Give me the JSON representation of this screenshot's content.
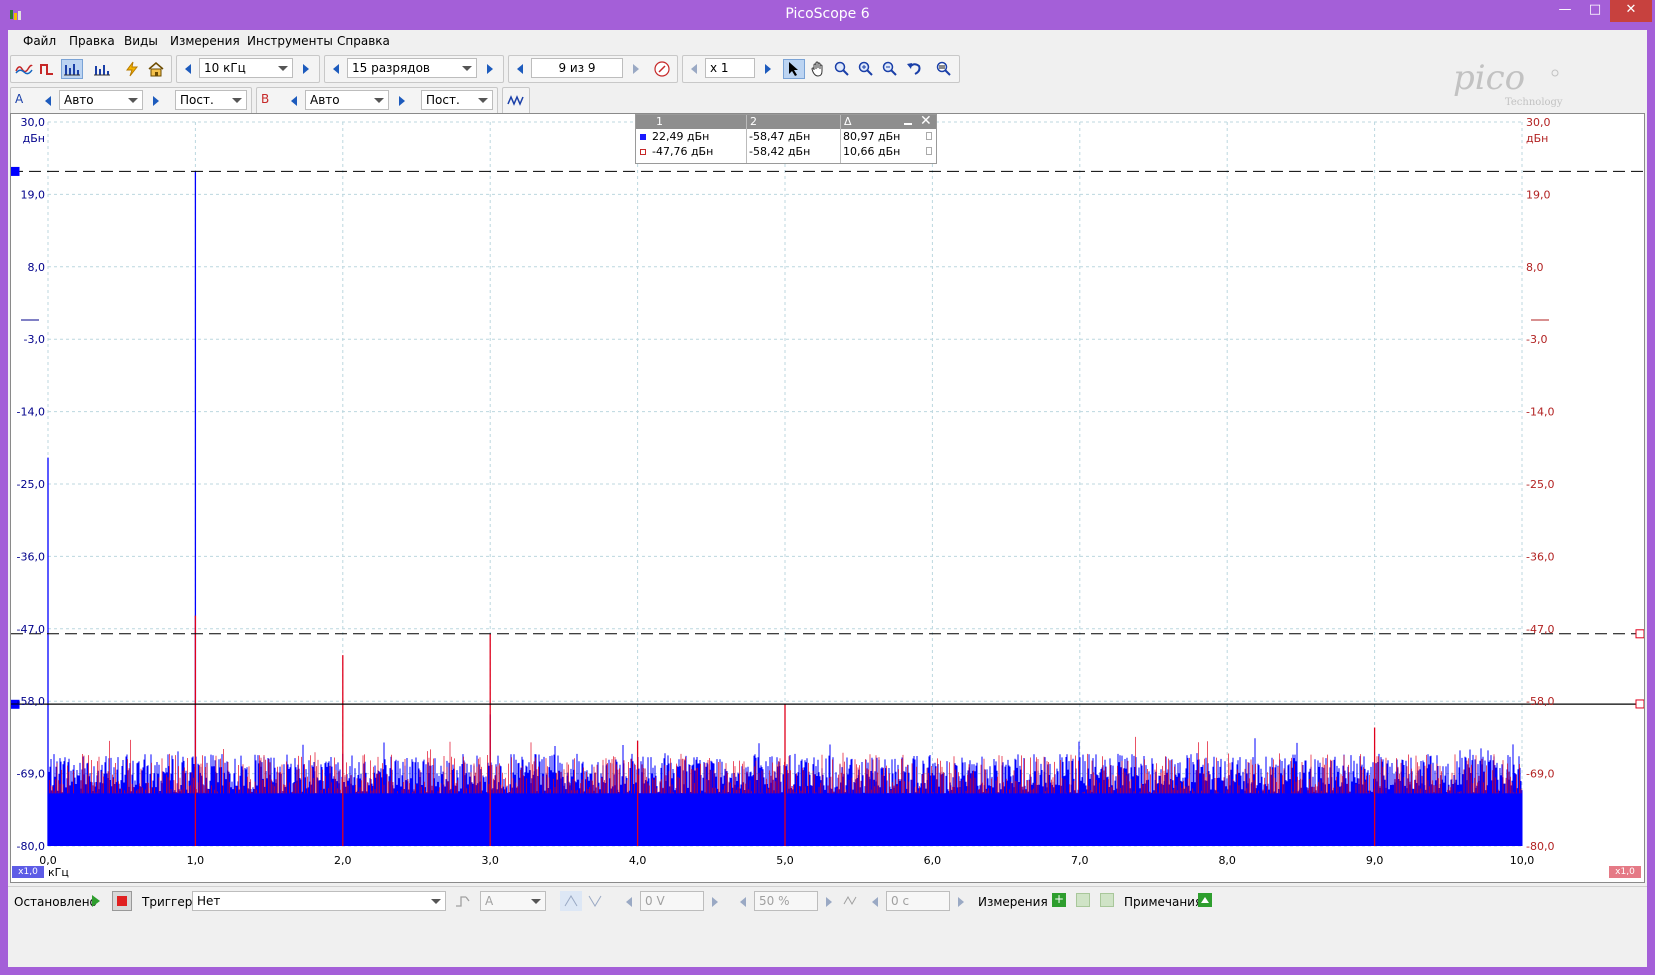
{
  "window": {
    "title": "PicoScope 6",
    "controls": {
      "minimize": "—",
      "maximize": "□",
      "close": "✕"
    }
  },
  "menu": [
    "Файл",
    "Правка",
    "Виды",
    "Измерения",
    "Инструменты",
    "Справка"
  ],
  "toolbar1": {
    "frequency": "10 кГц",
    "resolution": "15 разрядов",
    "buffer": "9 из 9",
    "zoom": "x 1"
  },
  "toolbar2": {
    "channel_a": {
      "label": "A",
      "range": "Авто",
      "coupling": "Пост."
    },
    "channel_b": {
      "label": "B",
      "range": "Авто",
      "coupling": "Пост."
    }
  },
  "logo": {
    "brand": "pico",
    "sub": "Technology"
  },
  "plot": {
    "y_unit": "дБн",
    "y_ticks": [
      "30,0",
      "19,0",
      "8,0",
      "-3,0",
      "-14,0",
      "-25,0",
      "-36,0",
      "-47,0",
      "-58,0",
      "-69,0",
      "-80,0"
    ],
    "x_ticks": [
      "0,0",
      "1,0",
      "2,0",
      "3,0",
      "4,0",
      "5,0",
      "6,0",
      "7,0",
      "8,0",
      "9,0",
      "10,0"
    ],
    "x_unit": "кГц",
    "x_scale_left": "x1,0",
    "x_scale_right": "x1,0",
    "colors": {
      "channel_a": "#0000ff",
      "channel_b": "#e0001c",
      "axis_a": "#00008b",
      "axis_b": "#b22222"
    }
  },
  "chart_data": {
    "type": "line",
    "title": "",
    "xlabel": "кГц",
    "ylabel": "дБн",
    "xlim": [
      0,
      10
    ],
    "ylim": [
      -80,
      30
    ],
    "series": [
      {
        "name": "A",
        "peaks": [
          {
            "x": 0.0,
            "y": -21
          },
          {
            "x": 1.0,
            "y": 22.49
          },
          {
            "x": 2.0,
            "y": -66
          },
          {
            "x": 3.0,
            "y": -60
          }
        ],
        "noise_floor": [
          -72,
          -66
        ]
      },
      {
        "name": "B",
        "peaks": [
          {
            "x": 1.0,
            "y": -45
          },
          {
            "x": 2.0,
            "y": -51
          },
          {
            "x": 3.0,
            "y": -47.76
          },
          {
            "x": 4.0,
            "y": -64
          },
          {
            "x": 5.0,
            "y": -58.5
          },
          {
            "x": 9.0,
            "y": -62
          }
        ],
        "noise_floor": [
          -74,
          -66
        ]
      }
    ],
    "rulers": [
      {
        "channel": "A",
        "value": 22.49,
        "style": "dashed"
      },
      {
        "channel": "B",
        "value": -47.76,
        "style": "dashed"
      },
      {
        "channel": "A",
        "value": -58.47,
        "style": "solid"
      },
      {
        "channel": "B",
        "value": -58.42,
        "style": "solid"
      }
    ]
  },
  "measure_table": {
    "headers": [
      "1",
      "2",
      "Δ"
    ],
    "rows": [
      {
        "c1": "22,49 дБн",
        "c2": "-58,47 дБн",
        "delta": "80,97 дБн"
      },
      {
        "c1": "-47,76 дБн",
        "c2": "-58,42 дБн",
        "delta": "10,66 дБн"
      }
    ]
  },
  "status": {
    "state": "Остановлено",
    "trigger_label": "Триггер",
    "trigger_value": "Нет",
    "trigger_source": "A",
    "threshold": "0 V",
    "pre_trigger": "50 %",
    "delay": "0 с",
    "measurements": "Измерения",
    "notes": "Примечания"
  }
}
